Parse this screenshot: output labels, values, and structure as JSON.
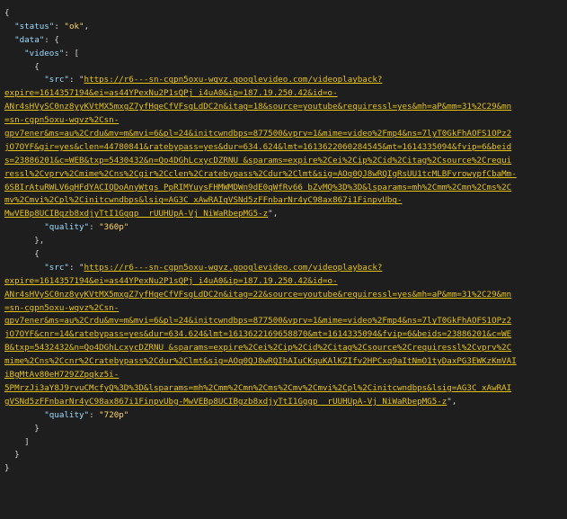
{
  "response": {
    "status_key": "\"status\"",
    "status_value": "\"ok\"",
    "data_key": "\"data\"",
    "videos_key": "\"videos\"",
    "src_key": "\"src\"",
    "quality_key": "\"quality\""
  },
  "videos": [
    {
      "src_first": "https://r6---sn-cgpn5oxu-wqvz.googlevideo.com/videoplayback?",
      "src_lines": [
        "expire=1614357194&ei=as44YPexNu2P1sQPj_i4uA0&ip=187.19.250.42&id=o-",
        "ANr4sHVySC0nz8yyKVtMX5mxgZ7yfHqeCfVFsgLdDC2n&itag=18&source=youtube&requiressl=yes&mh=aP&mm=31%2C29&mn",
        "=sn-cgpn5oxu-wqvz%2Csn-",
        "gpv7ener&ms=au%2Crdu&mv=m&mvi=6&pl=24&initcwndbps=877500&vprv=1&mime=video%2Fmp4&ns=7lyT0GkFhAOFS1OPz2",
        "jO7OYF&gir=yes&clen=44780841&ratebypass=yes&dur=634.624&lmt=1613622060284545&mt=1614335094&fvip=6&beid",
        "s=23886201&c=WEB&txp=5430432&n=Qo4DGhLcxycDZRNU_&sparams=expire%2Cei%2Cip%2Cid%2Citag%2Csource%2Crequi",
        "ressl%2Cvprv%2Cmime%2Cns%2Cgir%2Cclen%2Cratebypass%2Cdur%2Clmt&sig=AOq0QJ8wRQIgRsUU1tcMLBFvrowypfCbaMm-",
        "6SBIrAtuRWLV6qHFdYACIQDoAnyWtgs_PpRIMYuysFHMWMDWn9dE0qWfRv66_bZvMQ%3D%3D&lsparams=mh%2Cmm%2Cmn%2Cms%2C",
        "mv%2Cmvi%2Cpl%2Cinitcwndbps&lsig=AG3C_xAwRAIgVSNd5zFFnbarNr4yC98ax867i1FinpvUbg-",
        "MwVEBp8UCIBgzb8xdjyTtI1Gggp__rUUHUpA-Vj_NiWaRbepMG5-z"
      ],
      "quality": "\"360p\""
    },
    {
      "src_first": "https://r6---sn-cgpn5oxu-wqvz.googlevideo.com/videoplayback?",
      "src_lines": [
        "expire=1614357194&ei=as44YPexNu2P1sQPj_i4uA0&ip=187.19.250.42&id=o-",
        "ANr4sHVySC0nz8yyKVtMX5mxgZ7yfHqeCfVFsgLdDC2n&itag=22&source=youtube&requiressl=yes&mh=aP&mm=31%2C29&mn",
        "=sn-cgpn5oxu-wqvz%2Csn-",
        "gpv7ener&ms=au%2Crdu&mv=m&mvi=6&pl=24&initcwndbps=877500&vprv=1&mime=video%2Fmp4&ns=7lyT0GkFhAOFS1OPz2",
        "jO7OYF&cnr=14&ratebypass=yes&dur=634.624&lmt=1613622169658870&mt=1614335094&fvip=6&beids=23886201&c=WE",
        "B&txp=5432432&n=Qo4DGhLcxycDZRNU_&sparams=expire%2Cei%2Cip%2Cid%2Citag%2Csource%2Crequiressl%2Cvprv%2C",
        "mime%2Cns%2Ccnr%2Cratebypass%2Cdur%2Clmt&sig=AOq0QJ8wRQIhAIuCKquKAlKZIfv2HPCxq9aItNmO1tyDaxPG3EWKzKmVAI",
        "iBgMtAv80eH729ZZpqkz5i-",
        "5PMrzJi3aY8J9rvuCMcfyQ%3D%3D&lsparams=mh%2Cmm%2Cmn%2Cms%2Cmv%2Cmvi%2Cpl%2Cinitcwndbps&lsig=AG3C_xAwRAI",
        "gVSNd5zFFnbarNr4yC98ax867i1FinpvUbg-MwVEBp8UCIBgzb8xdjyTtI1Gggp__rUUHUpA-Vj_NiWaRbepMG5-z"
      ],
      "quality": "\"720p\""
    }
  ],
  "colors": {
    "background": "#1e1e1e",
    "key": "#9cdcfe",
    "value": "#ffd866",
    "url": "#e6c317",
    "punctuation": "#d4d4d4"
  }
}
